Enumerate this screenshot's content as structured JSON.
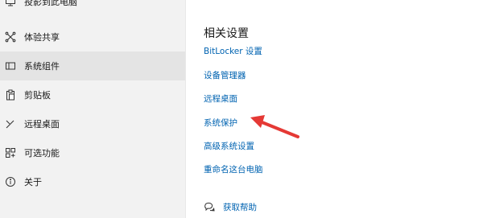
{
  "sidebar": {
    "items": [
      {
        "label": "投影到此电脑",
        "icon": "project-icon"
      },
      {
        "label": "体验共享",
        "icon": "share-experience-icon"
      },
      {
        "label": "系统组件",
        "icon": "system-components-icon",
        "selected": true
      },
      {
        "label": "剪贴板",
        "icon": "clipboard-icon"
      },
      {
        "label": "远程桌面",
        "icon": "remote-desktop-icon"
      },
      {
        "label": "可选功能",
        "icon": "optional-features-icon"
      },
      {
        "label": "关于",
        "icon": "info-icon"
      }
    ]
  },
  "main": {
    "section_title": "相关设置",
    "links": [
      {
        "label": "BitLocker 设置"
      },
      {
        "label": "设备管理器"
      },
      {
        "label": "远程桌面"
      },
      {
        "label": "系统保护"
      },
      {
        "label": "高级系统设置"
      },
      {
        "label": "重命名这台电脑"
      }
    ],
    "help_label": "获取帮助"
  },
  "colors": {
    "link": "#0063b1",
    "sidebar_bg": "#f2f2f2",
    "selected_bg": "#e4e4e4",
    "annotation_arrow": "#e53935"
  }
}
